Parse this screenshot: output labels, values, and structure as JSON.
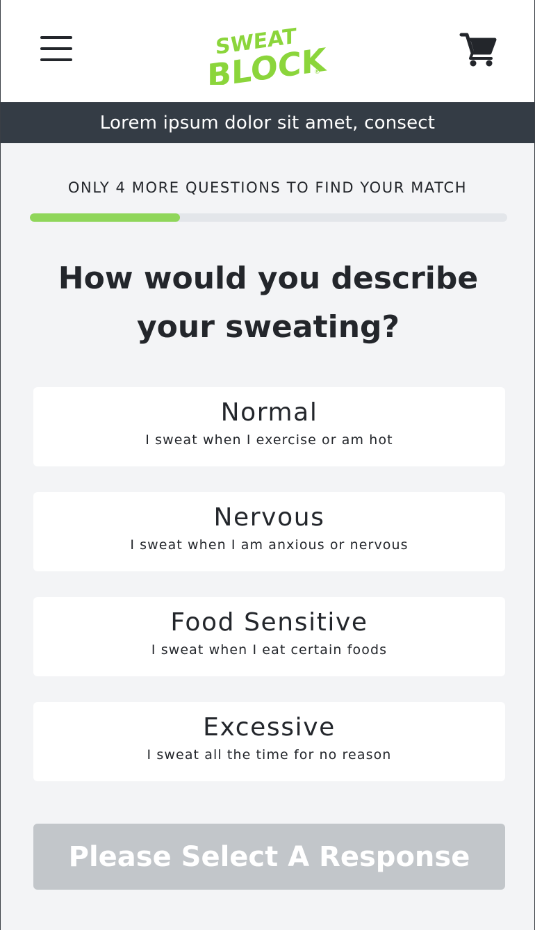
{
  "header": {
    "brand": {
      "line1": "SWEAT",
      "line2": "BLOCK",
      "mark": "®",
      "color": "#8bd53b"
    },
    "menu_icon": "hamburger-menu-icon",
    "cart_icon": "shopping-cart-icon"
  },
  "banner": {
    "text": "Lorem ipsum dolor sit amet, consect"
  },
  "progress": {
    "label": "ONLY 4 MORE QUESTIONS TO FIND YOUR MATCH",
    "fraction": 0.314,
    "fill_color": "#8fd65a"
  },
  "question": {
    "text": "How would you describe your sweating?"
  },
  "options": [
    {
      "title": "Normal",
      "subtitle": "I sweat when I exercise or am hot"
    },
    {
      "title": "Nervous",
      "subtitle": "I sweat when I am anxious or nervous"
    },
    {
      "title": "Food Sensitive",
      "subtitle": "I sweat when I eat certain foods"
    },
    {
      "title": "Excessive",
      "subtitle": "I sweat all the time for no reason"
    }
  ],
  "submit": {
    "label": "Please Select A Response",
    "disabled": true
  }
}
